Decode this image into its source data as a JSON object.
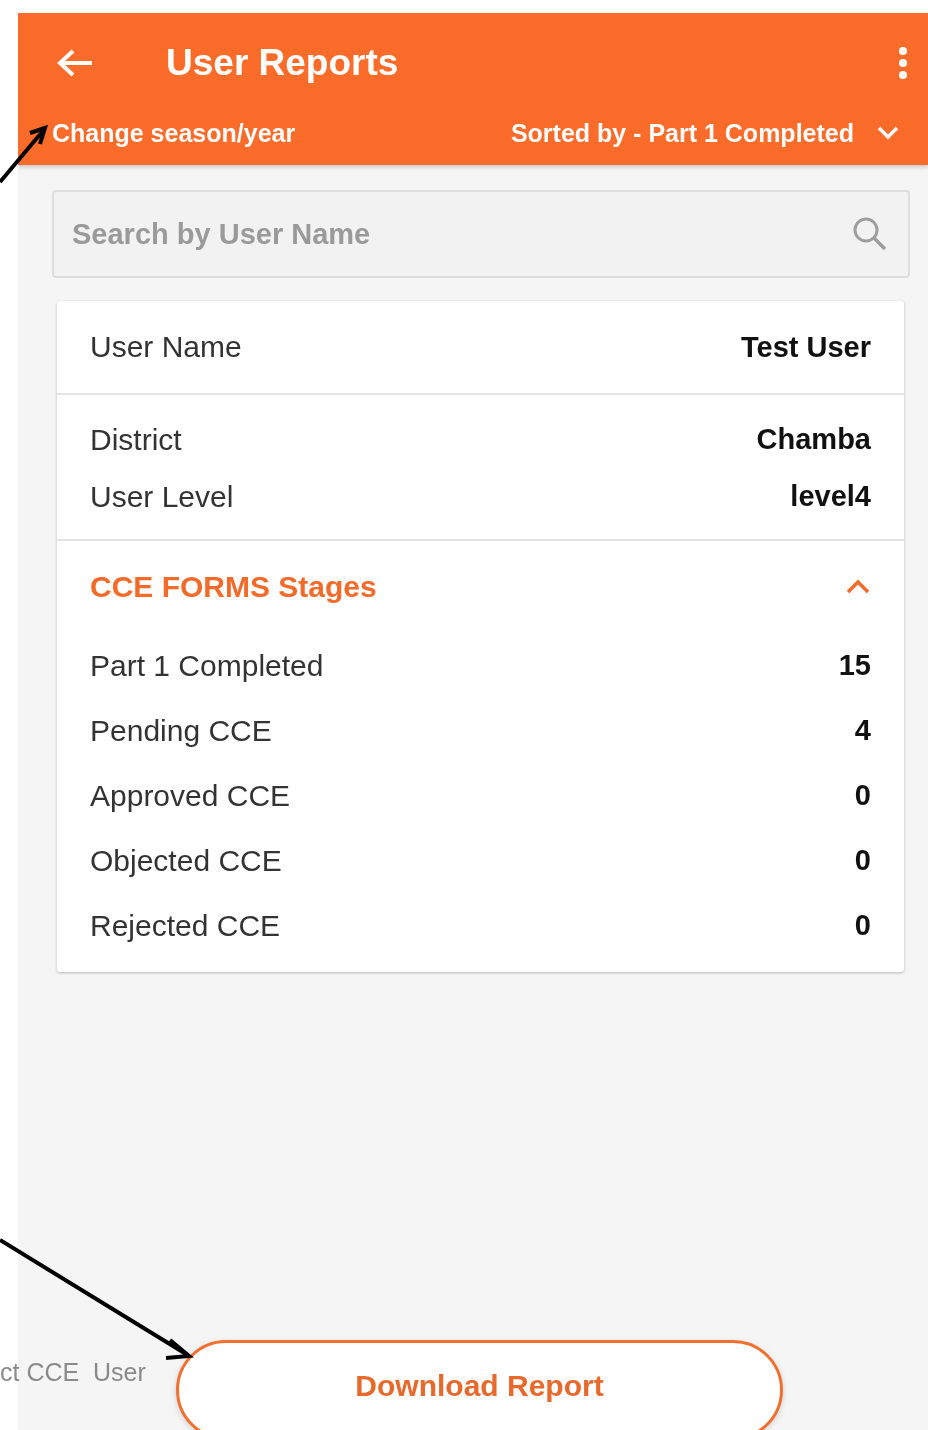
{
  "app_bar": {
    "title": "User Reports"
  },
  "sub_bar": {
    "season_link": "Change season/year",
    "sort": "Sorted by - Part 1 Completed"
  },
  "search": {
    "placeholder": "Search by User Name"
  },
  "card": {
    "user_name": {
      "label": "User Name",
      "value": "Test User"
    },
    "details": [
      {
        "label": "District",
        "value": "Chamba"
      },
      {
        "label": "User Level",
        "value": "level4"
      }
    ],
    "stages": {
      "title": "CCE FORMS Stages",
      "expanded": true,
      "items": [
        {
          "label": "Part 1 Completed",
          "value": "15"
        },
        {
          "label": "Pending CCE",
          "value": "4"
        },
        {
          "label": "Approved CCE",
          "value": "0"
        },
        {
          "label": "Objected CCE",
          "value": "0"
        },
        {
          "label": "Rejected CCE",
          "value": "0"
        }
      ]
    }
  },
  "download_button": {
    "label": "Download Report"
  },
  "side_caption": "ct CCE  User"
}
